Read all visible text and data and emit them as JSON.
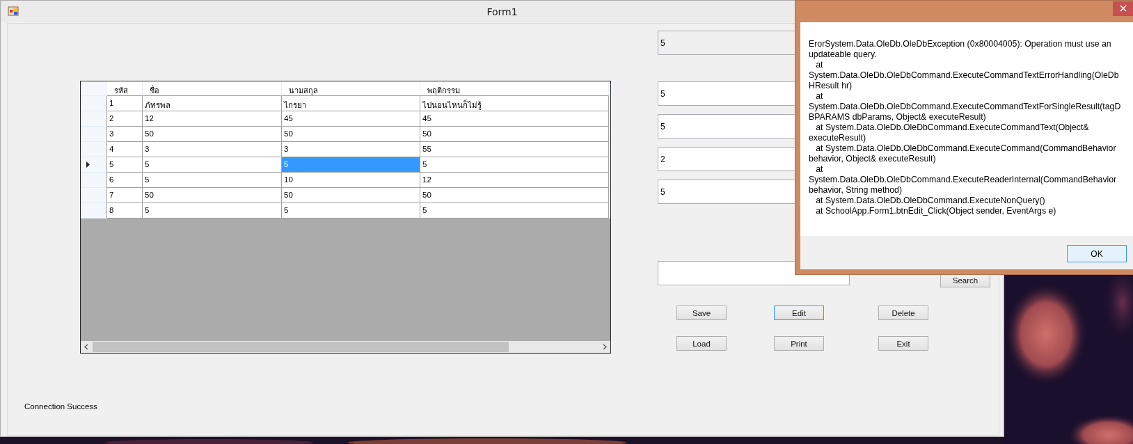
{
  "form": {
    "title": "Form1",
    "grid": {
      "columns": [
        "รหัส",
        "ชื่อ",
        "นามสกุล",
        "พฤติกรรม"
      ],
      "rows": [
        {
          "current": false,
          "cells": [
            {
              "text": "1",
              "selected": false
            },
            {
              "text": "ภัทรพล",
              "selected": false
            },
            {
              "text": "ไกรยา",
              "selected": false
            },
            {
              "text": "ไปนอนไหนก็ไม่รู้",
              "selected": false
            }
          ]
        },
        {
          "current": false,
          "cells": [
            {
              "text": "2",
              "selected": false
            },
            {
              "text": "12",
              "selected": false
            },
            {
              "text": "45",
              "selected": false
            },
            {
              "text": "45",
              "selected": false
            }
          ]
        },
        {
          "current": false,
          "cells": [
            {
              "text": "3",
              "selected": false
            },
            {
              "text": "50",
              "selected": false
            },
            {
              "text": "50",
              "selected": false
            },
            {
              "text": "50",
              "selected": false
            }
          ]
        },
        {
          "current": false,
          "cells": [
            {
              "text": "4",
              "selected": false
            },
            {
              "text": "3",
              "selected": false
            },
            {
              "text": "3",
              "selected": false
            },
            {
              "text": "55",
              "selected": false
            }
          ]
        },
        {
          "current": true,
          "cells": [
            {
              "text": "5",
              "selected": false
            },
            {
              "text": "5",
              "selected": false
            },
            {
              "text": "5",
              "selected": true
            },
            {
              "text": "5",
              "selected": false
            }
          ]
        },
        {
          "current": false,
          "cells": [
            {
              "text": "6",
              "selected": false
            },
            {
              "text": "5",
              "selected": false
            },
            {
              "text": "10",
              "selected": false
            },
            {
              "text": "12",
              "selected": false
            }
          ]
        },
        {
          "current": false,
          "cells": [
            {
              "text": "7",
              "selected": false
            },
            {
              "text": "50",
              "selected": false
            },
            {
              "text": "50",
              "selected": false
            },
            {
              "text": "50",
              "selected": false
            }
          ]
        },
        {
          "current": false,
          "cells": [
            {
              "text": "8",
              "selected": false
            },
            {
              "text": "5",
              "selected": false
            },
            {
              "text": "5",
              "selected": false
            },
            {
              "text": "5",
              "selected": false
            }
          ]
        }
      ]
    },
    "fields": [
      {
        "value": "5",
        "readonly": true
      },
      {
        "value": "5",
        "readonly": false
      },
      {
        "value": "5",
        "readonly": false
      },
      {
        "value": "2",
        "readonly": false
      },
      {
        "value": "5",
        "readonly": false
      }
    ],
    "search_button": "Search",
    "buttons": [
      {
        "label": "Save",
        "focused": false
      },
      {
        "label": "Edit",
        "focused": true
      },
      {
        "label": "Delete",
        "focused": false
      },
      {
        "label": "Load",
        "focused": false
      },
      {
        "label": "Print",
        "focused": false
      },
      {
        "label": "Exit",
        "focused": false
      }
    ],
    "status": "Connection Success"
  },
  "dialog": {
    "message": "ErorSystem.Data.OleDb.OleDbException (0x80004005): Operation must use an\nupdateable query.\n   at\nSystem.Data.OleDb.OleDbCommand.ExecuteCommandTextErrorHandling(OleDb\nHResult hr)\n   at\nSystem.Data.OleDb.OleDbCommand.ExecuteCommandTextForSingleResult(tagD\nBPARAMS dbParams, Object& executeResult)\n   at System.Data.OleDb.OleDbCommand.ExecuteCommandText(Object&\nexecuteResult)\n   at System.Data.OleDb.OleDbCommand.ExecuteCommand(CommandBehavior\nbehavior, Object& executeResult)\n   at\nSystem.Data.OleDb.OleDbCommand.ExecuteReaderInternal(CommandBehavior\nbehavior, String method)\n   at System.Data.OleDb.OleDbCommand.ExecuteNonQuery()\n   at SchoolApp.Form1.btnEdit_Click(Object sender, EventArgs e)",
    "ok_button": "OK"
  }
}
